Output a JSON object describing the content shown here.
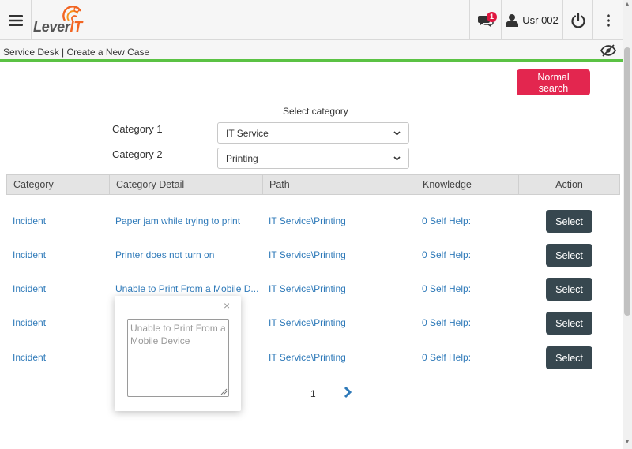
{
  "header": {
    "logo_text": "Lever",
    "logo_suffix": "IT",
    "notification_count": "1",
    "user_name": "Usr 002"
  },
  "breadcrumb": {
    "text": "Service Desk | Create a New Case"
  },
  "actions": {
    "normal_search_label": "Normal search"
  },
  "filters": {
    "title": "Select category",
    "category1_label": "Category 1",
    "category1_value": "IT Service",
    "category2_label": "Category 2",
    "category2_value": "Printing"
  },
  "table": {
    "headers": [
      "Category",
      "Category Detail",
      "Path",
      "Knowledge",
      "Action"
    ],
    "rows": [
      {
        "category": "Incident",
        "detail": "Paper jam while trying to print",
        "path": "IT Service\\Printing",
        "knowledge": "0 Self Help:",
        "action": "Select"
      },
      {
        "category": "Incident",
        "detail": "Printer does not turn on",
        "path": "IT Service\\Printing",
        "knowledge": "0 Self Help:",
        "action": "Select"
      },
      {
        "category": "Incident",
        "detail": "Unable to Print From a Mobile D...",
        "path": "IT Service\\Printing",
        "knowledge": "0 Self Help:",
        "action": "Select"
      },
      {
        "category": "Incident",
        "detail": "",
        "path": "IT Service\\Printing",
        "knowledge": "0 Self Help:",
        "action": "Select"
      },
      {
        "category": "Incident",
        "detail": "",
        "path": "IT Service\\Printing",
        "knowledge": "0 Self Help:",
        "action": "Select"
      }
    ]
  },
  "pagination": {
    "current_page": "1"
  },
  "popover": {
    "close_symbol": "×",
    "text": "Unable to Print From a Mobile Device"
  },
  "colors": {
    "accent_green": "#5bc244",
    "normal_search": "#e3264f",
    "select_button": "#37474f",
    "link_blue": "#2f7ab9"
  },
  "icons": [
    "menu-icon",
    "chat-icon",
    "user-icon",
    "power-icon",
    "more-vert-icon",
    "eye-slash-icon",
    "chevron-right-icon",
    "chevron-down-icon"
  ]
}
